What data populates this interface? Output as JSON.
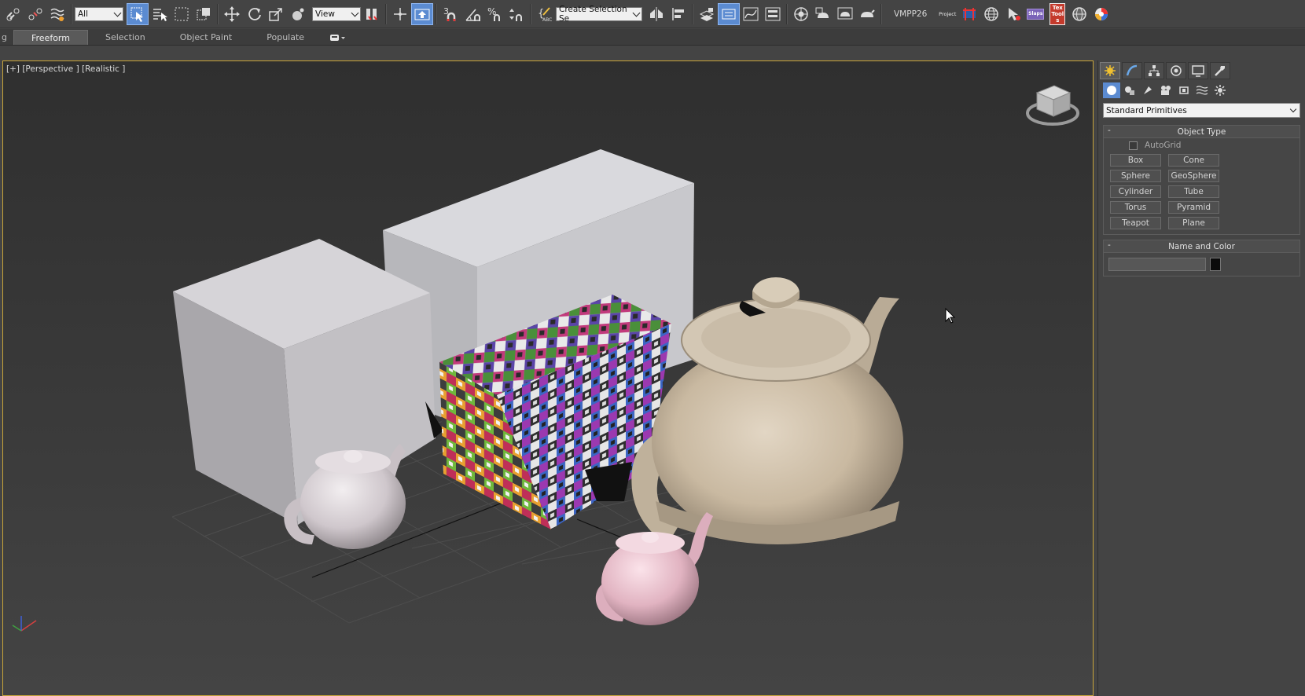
{
  "toolbar": {
    "selection_filter": "All",
    "reference_coord": "View",
    "named_selection_placeholder": "Create Selection Se",
    "snap_label": "3",
    "angle_snap_label": "%",
    "user_label": "VMPP26",
    "project_label": "Project",
    "slaps_label": "Slaps",
    "textools_label": "TexTools"
  },
  "ribbon": {
    "tabs": [
      "g",
      "Freeform",
      "Selection",
      "Object Paint",
      "Populate"
    ],
    "active": "Freeform"
  },
  "viewport": {
    "label": "[+] [Perspective ] [Realistic ]"
  },
  "command_panel": {
    "category_dropdown": "Standard Primitives",
    "object_type": {
      "title": "Object Type",
      "autogrid_label": "AutoGrid",
      "autogrid_checked": false,
      "buttons": [
        "Box",
        "Cone",
        "Sphere",
        "GeoSphere",
        "Cylinder",
        "Tube",
        "Torus",
        "Pyramid",
        "Teapot",
        "Plane"
      ]
    },
    "name_and_color": {
      "title": "Name and Color",
      "name": "",
      "color": "#0b0b0b"
    },
    "collapse_symbol": "-"
  },
  "colors": {
    "accent_blue": "#5b8bd1",
    "viewport_border": "#c9a53a",
    "panel_bg": "#444444"
  }
}
